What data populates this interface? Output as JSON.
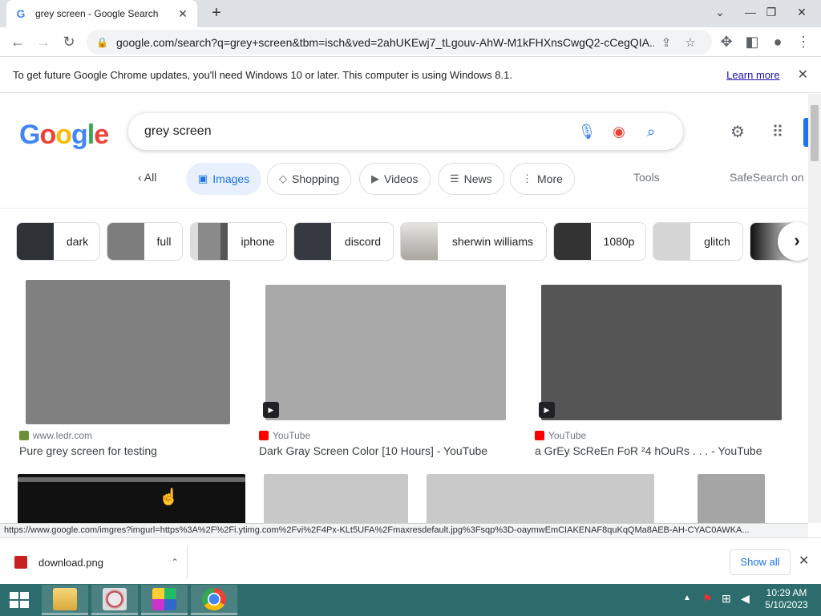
{
  "browser": {
    "tab_title": "grey screen - Google Search",
    "tab_favicon": "G",
    "url": "google.com/search?q=grey+screen&tbm=isch&ved=2ahUKEwj7_tLgouv-AhW-M1kFHXnsCwgQ2-cCegQIA..."
  },
  "infobar": {
    "message": "To get future Google Chrome updates, you'll need Windows 10 or later. This computer is using Windows 8.1.",
    "learn_more": "Learn more"
  },
  "search": {
    "logo": "Google",
    "query": "grey screen"
  },
  "tabs": {
    "all": "All",
    "items": [
      {
        "label": "Images",
        "icon": "image-icon"
      },
      {
        "label": "Shopping",
        "icon": "tag-icon"
      },
      {
        "label": "Videos",
        "icon": "play-icon"
      },
      {
        "label": "News",
        "icon": "news-icon"
      },
      {
        "label": "More",
        "icon": "more-vert-icon"
      }
    ],
    "tools": "Tools",
    "safesearch": "SafeSearch on"
  },
  "refine": [
    {
      "label": "dark",
      "thumb": "#2e3236"
    },
    {
      "label": "full",
      "thumb": "#7d7d7d"
    },
    {
      "label": "iphone",
      "thumb": "#9a9a9a"
    },
    {
      "label": "discord",
      "thumb": "#36393f"
    },
    {
      "label": "sherwin williams",
      "thumb": "#bcbab4"
    },
    {
      "label": "1080p",
      "thumb": "#333333"
    },
    {
      "label": "glitch",
      "thumb": "#d6d6d6"
    }
  ],
  "results": [
    {
      "source": "www.ledr.com",
      "title": "Pure grey screen for testing",
      "color": "#808080",
      "video": false
    },
    {
      "source": "YouTube",
      "title": "Dark Gray Screen Color [10 Hours] - YouTube",
      "color": "#a9a9a9",
      "video": true
    },
    {
      "source": "YouTube",
      "title": "a GrEy ScReEn FoR ²4 hOuRs . . . - YouTube",
      "color": "#555555",
      "video": true
    }
  ],
  "status_url": "https://www.google.com/imgres?imgurl=https%3A%2F%2Fi.ytimg.com%2Fvi%2F4Px-KLt5UFA%2Fmaxresdefault.jpg%3Fsqp%3D-oaymwEmCIAKENAF8quKqQMa8AEB-AH-CYAC0AWKA...",
  "download": {
    "filename": "download.png",
    "show_all": "Show all"
  },
  "clock": {
    "time": "10:29 AM",
    "date": "5/10/2023"
  }
}
